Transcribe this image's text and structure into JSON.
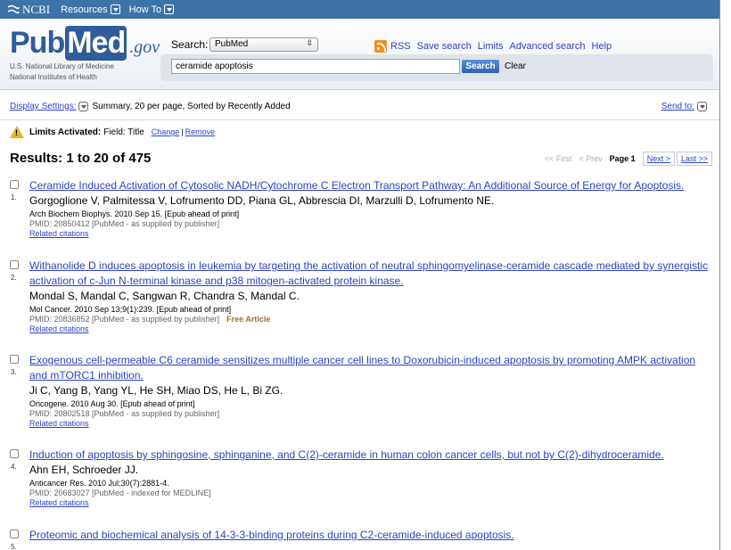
{
  "ncbi": {
    "logo": "NCBI",
    "resources": "Resources",
    "howto": "How To"
  },
  "header": {
    "logo_pub": "Pub",
    "logo_med": "Med",
    "logo_gov": ".gov",
    "sub1": "U.S. National Library of Medicine",
    "sub2": "National Institutes of Health",
    "search_label": "Search:",
    "db_value": "PubMed",
    "query": "ceramide apoptosis",
    "search_btn": "Search",
    "clear": "Clear",
    "links": {
      "rss": "RSS",
      "save": "Save search",
      "limits": "Limits",
      "advanced": "Advanced search",
      "help": "Help"
    }
  },
  "settings": {
    "display_label": "Display Settings:",
    "display_value": "Summary, 20 per page, Sorted by Recently Added",
    "send_to": "Send to:"
  },
  "limits": {
    "label": "Limits Activated:",
    "value": "Field: Title",
    "change": "Change",
    "sep": "|",
    "remove": "Remove"
  },
  "results": {
    "title": "Results: 1 to 20 of 475",
    "pager": {
      "first": "<< First",
      "prev": "< Prev",
      "page": "Page 1",
      "next": "Next >",
      "last": "Last >>"
    },
    "items": [
      {
        "num": "1.",
        "title": "Ceramide Induced Activation of Cytosolic NADH/Cytochrome C Electron Transport Pathway: An Additional Source of Energy for Apoptosis.",
        "authors": "Gorgoglione V, Palmitessa V, Lofrumento DD, Piana GL, Abbrescia DI, Marzulli D, Lofrumento NE.",
        "journal": "Arch Biochem Biophys. 2010 Sep 15. [Epub ahead of print]",
        "pmid": "PMID: 20850412 [PubMed - as supplied by publisher]",
        "free": "",
        "related": "Related citations"
      },
      {
        "num": "2.",
        "title": "Withanolide D induces apoptosis in leukemia by targeting the activation of neutral sphingomyelinase-ceramide cascade mediated by synergistic activation of c-Jun N-terminal kinase and p38 mitogen-activated protein kinase.",
        "authors": "Mondal S, Mandal C, Sangwan R, Chandra S, Mandal C.",
        "journal": "Mol Cancer. 2010 Sep 13;9(1):239. [Epub ahead of print]",
        "pmid": "PMID: 20836852 [PubMed - as supplied by publisher]",
        "free": "Free Article",
        "related": "Related citations"
      },
      {
        "num": "3.",
        "title": "Exogenous cell-permeable C6 ceramide sensitizes multiple cancer cell lines to Doxorubicin-induced apoptosis by promoting AMPK activation and mTORC1 inhibition.",
        "authors": "Ji C, Yang B, Yang YL, He SH, Miao DS, He L, Bi ZG.",
        "journal": "Oncogene. 2010 Aug 30. [Epub ahead of print]",
        "pmid": "PMID: 20802518 [PubMed - as supplied by publisher]",
        "free": "",
        "related": "Related citations"
      },
      {
        "num": "4.",
        "title": "Induction of apoptosis by sphingosine, sphinganine, and C(2)-ceramide in human colon cancer cells, but not by C(2)-dihydroceramide.",
        "authors": "Ahn EH, Schroeder JJ.",
        "journal": "Anticancer Res. 2010 Jul;30(7):2881-4.",
        "pmid": "PMID: 20683027 [PubMed - indexed for MEDLINE]",
        "free": "",
        "related": "Related citations"
      },
      {
        "num": "5.",
        "title": "Proteomic and biochemical analysis of 14-3-3-binding proteins during C2-ceramide-induced apoptosis.",
        "authors": "",
        "journal": "",
        "pmid": "",
        "free": "",
        "related": ""
      }
    ]
  }
}
